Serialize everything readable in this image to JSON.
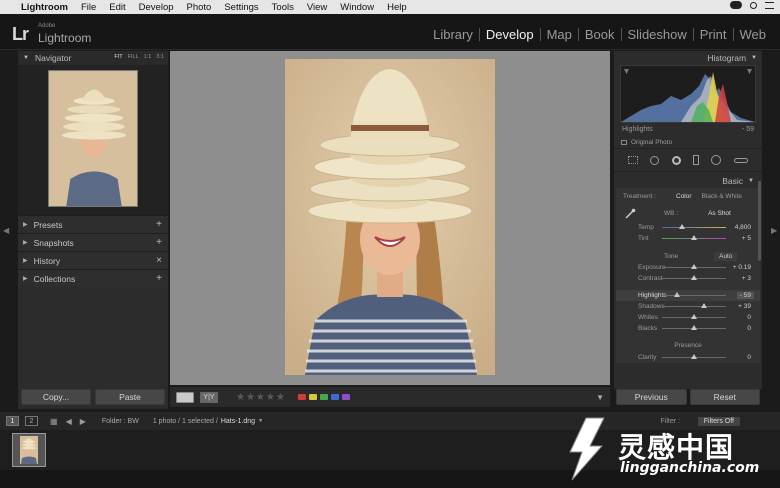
{
  "menubar": {
    "app": "Lightroom",
    "items": [
      "File",
      "Edit",
      "Develop",
      "Photo",
      "Settings",
      "Tools",
      "View",
      "Window",
      "Help"
    ]
  },
  "header": {
    "logo": "Lr",
    "adobe": "Adobe",
    "product": "Lightroom",
    "modules": [
      "Library",
      "Develop",
      "Map",
      "Book",
      "Slideshow",
      "Print",
      "Web"
    ],
    "active_module": "Develop"
  },
  "left_panel": {
    "navigator_label": "Navigator",
    "nav_modes": [
      "FIT",
      "FILL",
      "1:1",
      "3:1"
    ],
    "sections": [
      {
        "label": "Presets",
        "action": "+"
      },
      {
        "label": "Snapshots",
        "action": "+"
      },
      {
        "label": "History",
        "action": "×"
      },
      {
        "label": "Collections",
        "action": "+"
      }
    ],
    "copy_label": "Copy...",
    "paste_label": "Paste"
  },
  "toolbar": {
    "yy_label": "Y|Y",
    "stars": "★★★★★",
    "color_labels": [
      "#d23b3b",
      "#d9c43b",
      "#45a84a",
      "#3f6ad6",
      "#8e4fc7"
    ]
  },
  "right_panel": {
    "histogram_label": "Histogram",
    "highlights_info_label": "Highlights",
    "highlights_info_value": "- 59",
    "original_photo": "Original Photo",
    "basic_label": "Basic",
    "treatment_label": "Treatment :",
    "treatment_color": "Color",
    "treatment_bw": "Black & White",
    "wb_label": "WB :",
    "wb_value": "As Shot",
    "sliders_wb": [
      {
        "label": "Temp",
        "value": "4,800",
        "pos": 0.3
      },
      {
        "label": "Tint",
        "value": "+ 5",
        "pos": 0.5
      }
    ],
    "tone_label": "Tone",
    "auto_label": "Auto",
    "sliders_tone": [
      {
        "label": "Exposure",
        "value": "+ 0.19",
        "pos": 0.5
      },
      {
        "label": "Contrast",
        "value": "+ 3",
        "pos": 0.5
      }
    ],
    "sliders_tone2": [
      {
        "label": "Highlights",
        "value": "- 59",
        "pos": 0.22
      },
      {
        "label": "Shadows",
        "value": "+ 39",
        "pos": 0.65
      },
      {
        "label": "Whites",
        "value": "0",
        "pos": 0.5
      },
      {
        "label": "Blacks",
        "value": "0",
        "pos": 0.5
      }
    ],
    "presence_label": "Presence",
    "sliders_presence": [
      {
        "label": "Clarity",
        "value": "0",
        "pos": 0.5
      }
    ],
    "previous_label": "Previous",
    "reset_label": "Reset"
  },
  "filmstrip": {
    "pages": [
      "1",
      "2"
    ],
    "folder": "Folder : BW",
    "count": "1 photo / 1 selected /",
    "file": "Hats-1.dng",
    "filter_label": "Filter :",
    "filter_value": "Filters Off"
  },
  "watermark": {
    "text": "灵感中国",
    "url": "lingganchina.com"
  }
}
